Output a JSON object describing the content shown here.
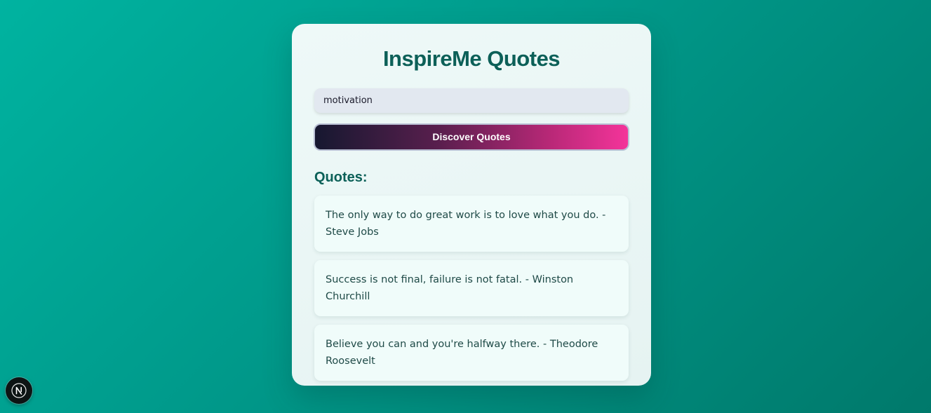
{
  "app": {
    "title": "InspireMe Quotes"
  },
  "search": {
    "value": "motivation"
  },
  "actions": {
    "discover_label": "Discover Quotes"
  },
  "results": {
    "heading": "Quotes:",
    "quotes": [
      "The only way to do great work is to love what you do. - Steve Jobs",
      "Success is not final, failure is not fatal. - Winston Churchill",
      "Believe you can and you're halfway there. - Theodore Roosevelt"
    ]
  },
  "dev_badge": {
    "icon": "nextjs-logo-icon",
    "letter": "N"
  },
  "colors": {
    "accent_title": "#0c6058",
    "button_gradient_start": "#161830",
    "button_gradient_end": "#f4349a",
    "background": "#00998a"
  }
}
